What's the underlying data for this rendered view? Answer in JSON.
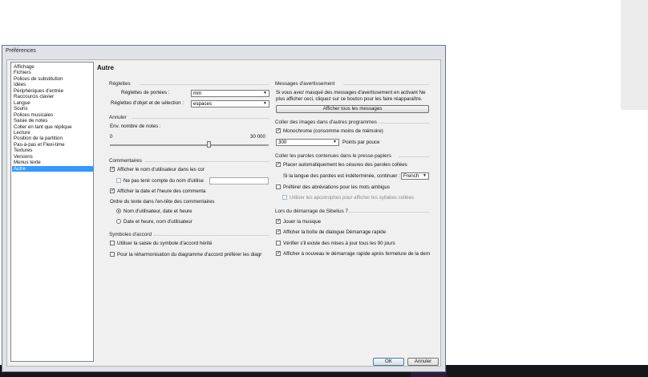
{
  "window": {
    "title": "Préférences"
  },
  "sidebar": {
    "items": [
      {
        "label": "Affichage"
      },
      {
        "label": "Fichiers"
      },
      {
        "label": "Polices de substitution"
      },
      {
        "label": "Idées"
      },
      {
        "label": "Périphériques d'entrée"
      },
      {
        "label": "Raccourcis clavier"
      },
      {
        "label": "Langue"
      },
      {
        "label": "Souris"
      },
      {
        "label": "Polices musicales"
      },
      {
        "label": "Saisie de notes"
      },
      {
        "label": "Coller en tant que réplique"
      },
      {
        "label": "Lecture"
      },
      {
        "label": "Position de la partition"
      },
      {
        "label": "Pas-à-pas et Flexi-time"
      },
      {
        "label": "Textures"
      },
      {
        "label": "Versions"
      },
      {
        "label": "Menus texte"
      },
      {
        "label": "Autre"
      }
    ],
    "selected_index": 17
  },
  "page": {
    "title": "Autre"
  },
  "left": {
    "reglettes": {
      "header": "Réglettes",
      "portees_label": "Réglettes de portées :",
      "portees_value": "mm",
      "objet_label": "Réglettes d'objet et de sélection :",
      "objet_value": "espaces"
    },
    "annuler": {
      "header": "Annuler",
      "env_label": "Env. nombre de notes :",
      "min_label": "0",
      "max_label": "30 000",
      "slider_fraction": 0.62
    },
    "commentaires": {
      "header": "Commentaires",
      "afficher_nom": {
        "label": "Afficher le nom d'utilisateur dans les cor",
        "checked": "✓"
      },
      "ne_pas_tenir": {
        "label": "Ne pas tenir compte du nom d'utilise",
        "checked": ""
      },
      "afficher_date": {
        "label": "Afficher la date et l'heure des commenta",
        "checked": "✓"
      },
      "ordre_label": "Ordre du texte dans l'en-tête des commentaires",
      "radio1": "Nom d'utilisateur, date et heure",
      "radio2": "Date et heure, nom d'utilisateur"
    },
    "symboles": {
      "header": "Symboles d'accord",
      "saisie": {
        "label": "Utiliser la saisie du symbole d'accord hérité",
        "checked": ""
      },
      "reharmonisation": {
        "label": "Pour la réharmonisation du diagramme d'accord préférer les diagr",
        "checked": ""
      }
    }
  },
  "right": {
    "messages": {
      "header": "Messages d'avertissement",
      "description_line1": "Si vous avez masqué des messages d'avertissement en activant Ne",
      "description_line2": "plus afficher ceci, cliquez sur ce bouton pour les faire réapparaître.",
      "button": "Afficher tous les messages"
    },
    "coller_images": {
      "header": "Coller des images dans d'autres programmes",
      "monochrome": {
        "label": "Monochrome (consomme moins de mémoire)",
        "checked": "✓"
      },
      "resolution_value": "300",
      "resolution_unit": "Points par pouce"
    },
    "coller_paroles": {
      "header": "Coller les paroles contenues dans le presse-papiers",
      "placer": {
        "label": "Placer automatiquement les césures des paroles collées",
        "checked": "✓"
      },
      "langue_label": "Si la langue des paroles est indéterminée, continuer :",
      "langue_value": "French",
      "preferer": {
        "label": "Préférer des abréviations pour les mots ambigus",
        "checked": ""
      },
      "apostrophes": {
        "label": "Utiliser les apostrophes pour afficher les syllabes collées",
        "checked": ""
      }
    },
    "demarrage": {
      "header": "Lors du démarrage de Sibelius 7",
      "jouer": {
        "label": "Jouer la musique",
        "checked": "✓"
      },
      "boite": {
        "label": "Afficher la boîte de dialogue Démarrage rapide",
        "checked": "✓"
      },
      "verifier": {
        "label": "Vérifier s'il existe des mises à jour tous les 90 jours",
        "checked": ""
      },
      "nouveau": {
        "label": "Afficher à nouveau le démarrage rapide après fermeture de la dern",
        "checked": "✓"
      }
    }
  },
  "footer": {
    "ok": "OK",
    "cancel": "Annuler"
  }
}
